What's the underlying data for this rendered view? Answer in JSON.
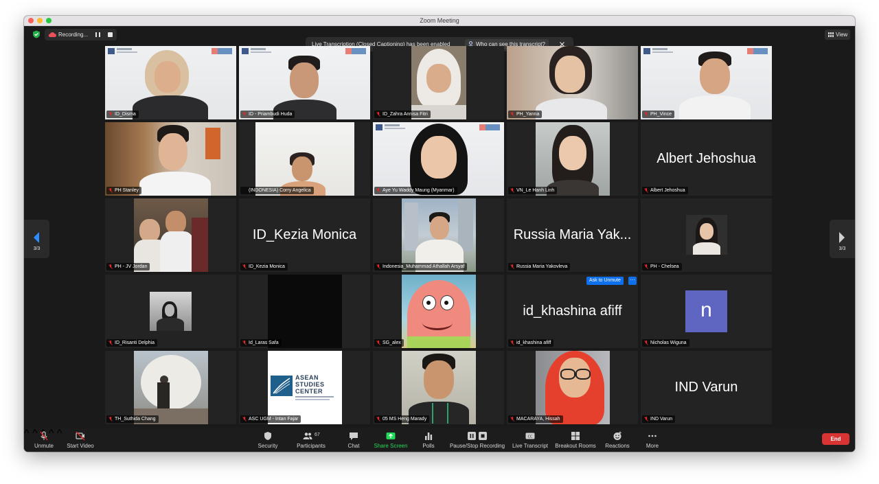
{
  "window": {
    "title": "Zoom Meeting"
  },
  "recording": {
    "label": "Recording..."
  },
  "notice": {
    "message": "Live Transcription (Closed Captioning) has been enabled",
    "link": "Who can see this transcript?"
  },
  "view": {
    "label": "View"
  },
  "pager": {
    "left": "3/3",
    "right": "3/3"
  },
  "tiles": [
    {
      "name": "ID_Disma"
    },
    {
      "name": "ID - Priambudi Huda"
    },
    {
      "name": "ID_Zahra Annisa Fitri"
    },
    {
      "name": "PH_Yanna"
    },
    {
      "name": "PH_Vince"
    },
    {
      "name": "PH Stanley"
    },
    {
      "name": "(INDONESIA) Corry Angelica"
    },
    {
      "name": "Aye Yu Waddy Maung (Myanmar)"
    },
    {
      "name": "VN_Le Hanh Linh"
    },
    {
      "name": "Albert Jehoshua",
      "display": "Albert Jehoshua"
    },
    {
      "name": "PH - JV Jordan"
    },
    {
      "name": "ID_Kezia Monica",
      "display": "ID_Kezia Monica"
    },
    {
      "name": "Indonesia_Muhammad Athallah Arsyaf"
    },
    {
      "name": "Russia Maria Yakovleva",
      "display": "Russia Maria Yak..."
    },
    {
      "name": "PH - Chelsea"
    },
    {
      "name": "ID_Risanti Delphia"
    },
    {
      "name": "Id_Laras Safa"
    },
    {
      "name": "SG_alex"
    },
    {
      "name": "id_khashina afiff",
      "display": "id_khashina afiff",
      "ask": "Ask to Unmute",
      "more": "···"
    },
    {
      "name": "Nicholas Wiguna",
      "avatar": "n"
    },
    {
      "name": "TH_Suthida Chang"
    },
    {
      "name": "ASC UGM - Intan Fajar",
      "logo": {
        "line1": "ASEAN",
        "line2": "STUDIES",
        "line3": "CENTER"
      }
    },
    {
      "name": "05 MS Heng Marady"
    },
    {
      "name": "MACARAYA, Hissah"
    },
    {
      "name": "IND Varun",
      "display": "IND Varun"
    }
  ],
  "toolbar": {
    "unmute": "Unmute",
    "start_video": "Start Video",
    "security": "Security",
    "participants": "Participants",
    "participant_count": "67",
    "chat": "Chat",
    "share_screen": "Share Screen",
    "polls": "Polls",
    "pause_stop": "Pause/Stop Recording",
    "live_transcript": "Live Transcript",
    "breakout": "Breakout Rooms",
    "reactions": "Reactions",
    "more": "More",
    "end": "End"
  },
  "colors": {
    "share_green": "#23d959",
    "end_red": "#d93434",
    "accent_blue": "#0e71eb",
    "avatar_purple": "#5e66c2",
    "muted_red": "#e02828"
  }
}
